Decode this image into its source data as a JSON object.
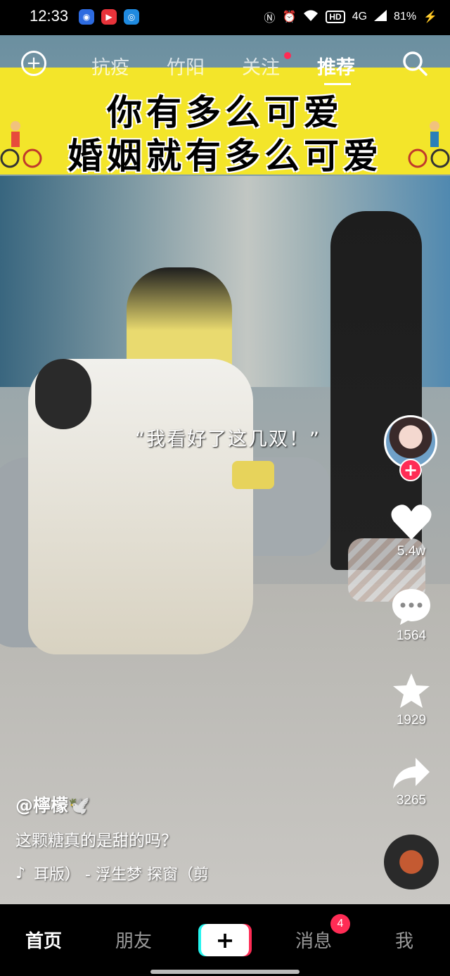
{
  "status_bar": {
    "time": "12:33",
    "signal": "4G",
    "battery": "81%",
    "hd": "HD",
    "icons": [
      "nfc-icon",
      "alarm-icon",
      "wifi-icon",
      "signal-icon",
      "battery-icon"
    ]
  },
  "top_nav": {
    "tabs": [
      {
        "label": "抗疫"
      },
      {
        "label": "竹阳"
      },
      {
        "label": "关注"
      },
      {
        "label": "推荐"
      }
    ],
    "active_tab": "推荐"
  },
  "banner": {
    "line1": "你有多么可爱",
    "line2": "婚姻就有多么可爱"
  },
  "video": {
    "caption": "“我看好了这几双！”"
  },
  "rail": {
    "likes": "5.4w",
    "comments": "1564",
    "favorites": "1929",
    "shares": "3265"
  },
  "post": {
    "author": "@檸檬🕊️",
    "description": "这颗糖真的是甜的吗？",
    "music": "耳版） - 浮生梦    探窗（剪"
  },
  "bottom_nav": {
    "home": "首页",
    "friends": "朋友",
    "create": "+",
    "messages": "消息",
    "messages_badge": "4",
    "me": "我"
  },
  "colors": {
    "accent": "#ff2c55",
    "banner_bg": "#f3e52a"
  }
}
